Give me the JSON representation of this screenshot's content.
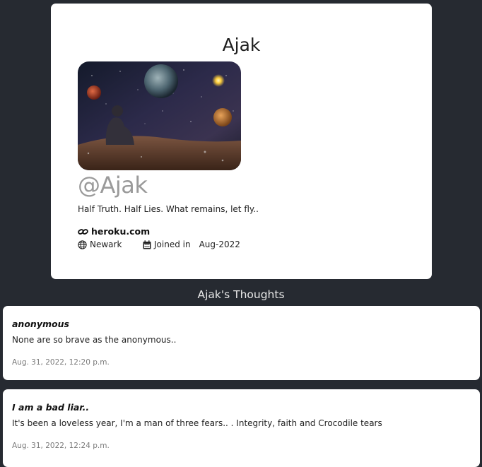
{
  "profile": {
    "name": "Ajak",
    "handle": "@Ajak",
    "bio": "Half Truth. Half Lies. What remains, let fly..",
    "website": "heroku.com",
    "location": "Newark",
    "joined_label": "Joined in",
    "joined_value": "Aug-2022",
    "banner_icon": "space-scene-banner"
  },
  "thoughts": {
    "section_title": "Ajak's Thoughts",
    "items": [
      {
        "title": "anonymous",
        "body": "None are so brave as the anonymous..",
        "date": "Aug. 31, 2022, 12:20 p.m."
      },
      {
        "title": "I am a bad liar..",
        "body": "It's been a loveless year, I'm a man of three fears.. . Integrity, faith and Crocodile tears",
        "date": "Aug. 31, 2022, 12:24 p.m."
      }
    ]
  },
  "colors": {
    "page_background": "#262a31",
    "card_background": "#ffffff",
    "handle_gray": "#9a9a9a"
  }
}
